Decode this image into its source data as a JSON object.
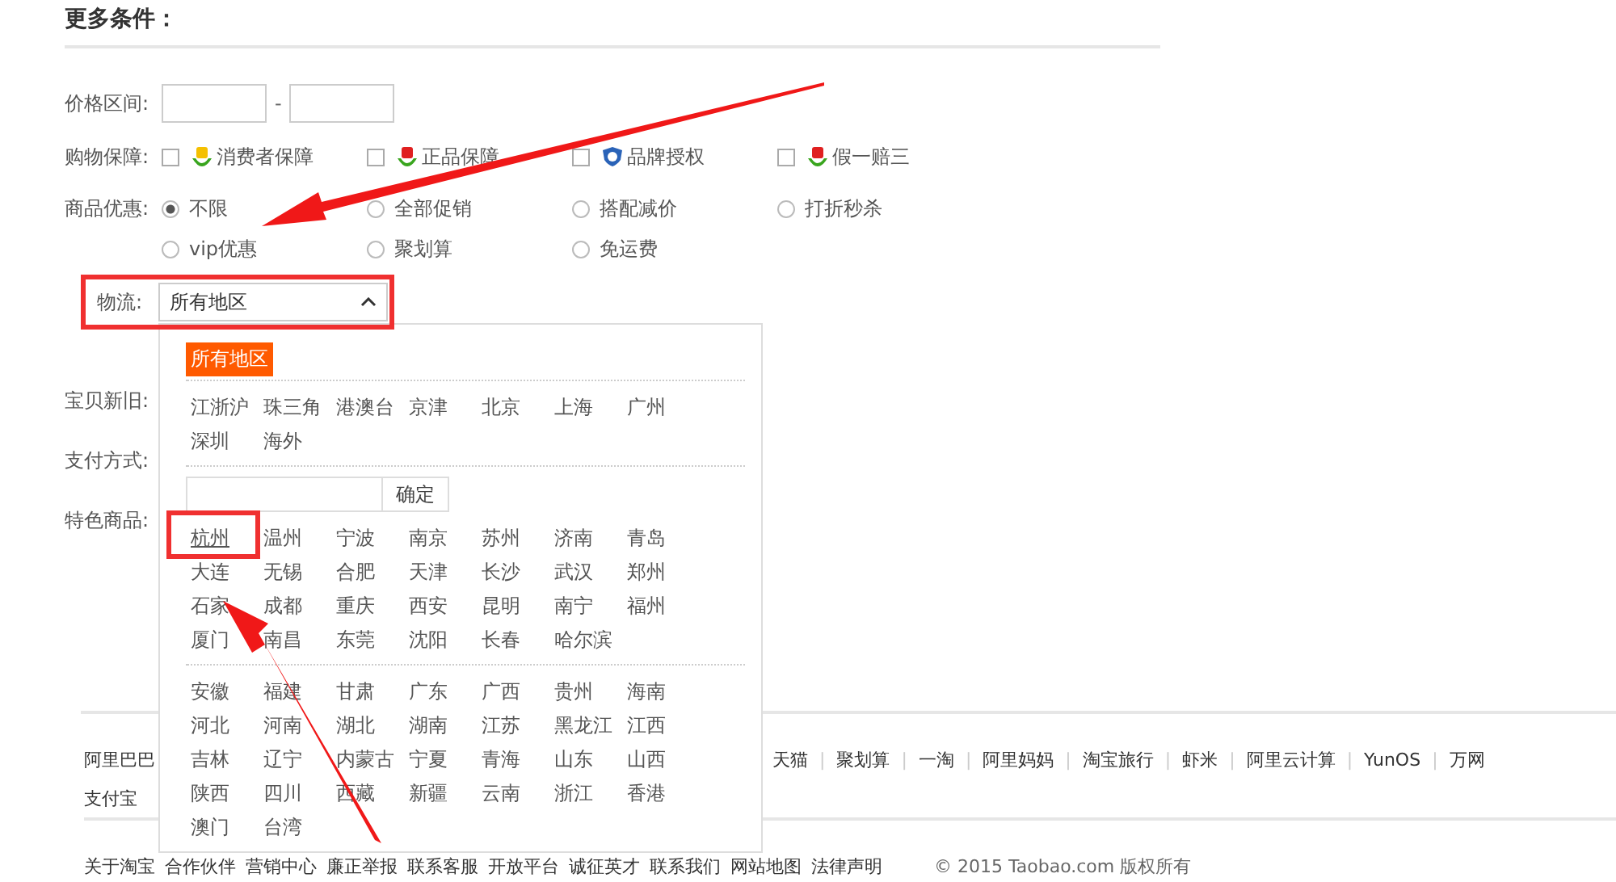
{
  "heading": "更多条件：",
  "price_range": {
    "label": "价格区间:",
    "separator": "-"
  },
  "guarantee": {
    "label": "购物保障:",
    "options": [
      {
        "label": "消费者保障",
        "checked": false
      },
      {
        "label": "正品保障",
        "checked": false
      },
      {
        "label": "品牌授权",
        "checked": false
      },
      {
        "label": "假一赔三",
        "checked": false
      }
    ]
  },
  "promotions": {
    "label": "商品优惠:",
    "options": [
      {
        "label": "不限",
        "selected": true
      },
      {
        "label": "全部促销",
        "selected": false
      },
      {
        "label": "搭配减价",
        "selected": false
      },
      {
        "label": "打折秒杀",
        "selected": false
      },
      {
        "label": "vip优惠",
        "selected": false
      },
      {
        "label": "聚划算",
        "selected": false
      },
      {
        "label": "免运费",
        "selected": false
      }
    ]
  },
  "logistics": {
    "label": "物流:",
    "value": "所有地区",
    "expanded": true,
    "dropdown": {
      "all_button": "所有地区",
      "confirm_button": "确定",
      "groups": [
        [
          {
            "label": "江浙沪",
            "selected": false
          },
          {
            "label": "珠三角",
            "selected": false
          },
          {
            "label": "港澳台",
            "selected": false
          },
          {
            "label": "京津",
            "selected": false
          },
          {
            "label": "北京",
            "selected": false
          },
          {
            "label": "上海",
            "selected": false
          },
          {
            "label": "广州",
            "selected": false
          },
          {
            "label": "深圳",
            "selected": false
          },
          {
            "label": "海外",
            "selected": false
          }
        ],
        [
          {
            "label": "杭州",
            "selected": true
          },
          {
            "label": "温州",
            "selected": false
          },
          {
            "label": "宁波",
            "selected": false
          },
          {
            "label": "南京",
            "selected": false
          },
          {
            "label": "苏州",
            "selected": false
          },
          {
            "label": "济南",
            "selected": false
          },
          {
            "label": "青岛",
            "selected": false
          },
          {
            "label": "大连",
            "selected": false
          },
          {
            "label": "无锡",
            "selected": false
          },
          {
            "label": "合肥",
            "selected": false
          },
          {
            "label": "天津",
            "selected": false
          },
          {
            "label": "长沙",
            "selected": false
          },
          {
            "label": "武汉",
            "selected": false
          },
          {
            "label": "郑州",
            "selected": false
          },
          {
            "label": "石家",
            "selected": false
          },
          {
            "label": "成都",
            "selected": false
          },
          {
            "label": "重庆",
            "selected": false
          },
          {
            "label": "西安",
            "selected": false
          },
          {
            "label": "昆明",
            "selected": false
          },
          {
            "label": "南宁",
            "selected": false
          },
          {
            "label": "福州",
            "selected": false
          },
          {
            "label": "厦门",
            "selected": false
          },
          {
            "label": "南昌",
            "selected": false
          },
          {
            "label": "东莞",
            "selected": false
          },
          {
            "label": "沈阳",
            "selected": false
          },
          {
            "label": "长春",
            "selected": false
          },
          {
            "label": "哈尔滨",
            "selected": false
          }
        ],
        [
          {
            "label": "安徽",
            "selected": false
          },
          {
            "label": "福建",
            "selected": false
          },
          {
            "label": "甘肃",
            "selected": false
          },
          {
            "label": "广东",
            "selected": false
          },
          {
            "label": "广西",
            "selected": false
          },
          {
            "label": "贵州",
            "selected": false
          },
          {
            "label": "海南",
            "selected": false
          },
          {
            "label": "河北",
            "selected": false
          },
          {
            "label": "河南",
            "selected": false
          },
          {
            "label": "湖北",
            "selected": false
          },
          {
            "label": "湖南",
            "selected": false
          },
          {
            "label": "江苏",
            "selected": false
          },
          {
            "label": "黑龙江",
            "selected": false
          },
          {
            "label": "江西",
            "selected": false
          },
          {
            "label": "吉林",
            "selected": false
          },
          {
            "label": "辽宁",
            "selected": false
          },
          {
            "label": "内蒙古",
            "selected": false
          },
          {
            "label": "宁夏",
            "selected": false
          },
          {
            "label": "青海",
            "selected": false
          },
          {
            "label": "山东",
            "selected": false
          },
          {
            "label": "山西",
            "selected": false
          },
          {
            "label": "陕西",
            "selected": false
          },
          {
            "label": "四川",
            "selected": false
          },
          {
            "label": "西藏",
            "selected": false
          },
          {
            "label": "新疆",
            "selected": false
          },
          {
            "label": "云南",
            "selected": false
          },
          {
            "label": "浙江",
            "selected": false
          },
          {
            "label": "香港",
            "selected": false
          },
          {
            "label": "澳门",
            "selected": false
          },
          {
            "label": "台湾",
            "selected": false
          }
        ]
      ]
    }
  },
  "other_filters": [
    "宝贝新旧:",
    "支付方式:",
    "特色商品:"
  ],
  "footer": {
    "row_1_start": [
      "阿里巴巴"
    ],
    "separator": "|",
    "row_1_end": [
      "天猫",
      "聚划算",
      "一淘",
      "阿里妈妈",
      "淘宝旅行",
      "虾米",
      "阿里云计算",
      "YunOS",
      "万网"
    ],
    "row_2": [
      "支付宝"
    ],
    "bottom_links": [
      "关于淘宝",
      "合作伙伴",
      "营销中心",
      "廉正举报",
      "联系客服",
      "开放平台",
      "诚征英才",
      "联系我们",
      "网站地图",
      "法律声明"
    ],
    "copyright": "© 2015 Taobao.com 版权所有"
  }
}
